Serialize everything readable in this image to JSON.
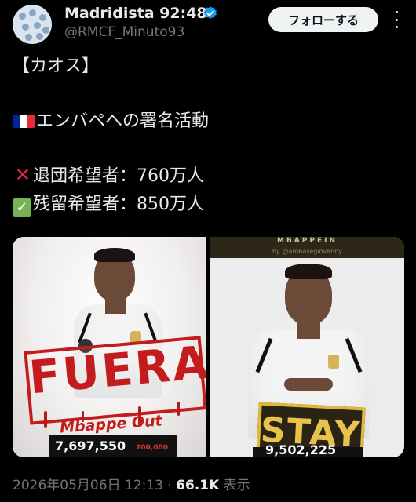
{
  "account": {
    "name": "Madridista 92:48",
    "handle": "@RMCF_Minuto93",
    "follow_label": "フォローする",
    "verified_color": "#1d9bf0"
  },
  "tweet": {
    "line1": "【カオス】",
    "line2_text": "エンバペへの署名活動",
    "line2_flag": "france-flag",
    "line3_text": "退団希望者：760万人",
    "line3_icon": "cross-mark-icon",
    "line4_text": "残留希望者：850万人",
    "line4_icon": "check-mark-icon"
  },
  "media": {
    "left": {
      "stamp": "FUERA",
      "caption": "Mbappe Out",
      "count": "7,697,550",
      "count_secondary": "200,000"
    },
    "right": {
      "header": "MBAPPEIN",
      "byline": "by @arobasegiovanny",
      "stamp": "STAY",
      "count": "9,502,225"
    }
  },
  "meta": {
    "timestamp": "2026年05月06日 12:13",
    "separator": "·",
    "views_count": "66.1K",
    "views_label": "表示"
  }
}
